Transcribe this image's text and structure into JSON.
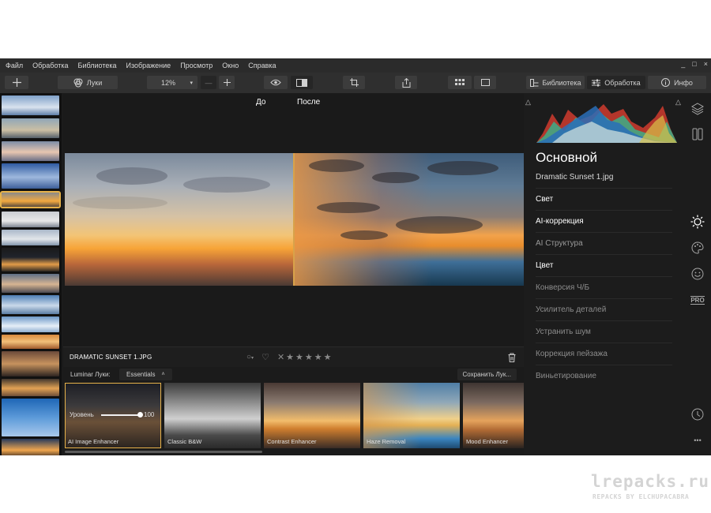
{
  "menu": [
    "Файл",
    "Обработка",
    "Библиотека",
    "Изображение",
    "Просмотр",
    "Окно",
    "Справка"
  ],
  "window_controls": [
    "_",
    "□",
    "×"
  ],
  "toolbar": {
    "looks_label": "Луки",
    "zoom": "12%",
    "zoom_minus": "—",
    "library_label": "Библиотека",
    "edit_label": "Обработка",
    "info_label": "Инфо"
  },
  "viewer": {
    "before_label": "До",
    "after_label": "После"
  },
  "infobar": {
    "filename": "DRAMATIC SUNSET 1.JPG",
    "stars": [
      "★",
      "★",
      "★",
      "★",
      "★"
    ]
  },
  "looks": {
    "label": "Luminar Луки:",
    "category": "Essentials",
    "save_label": "Сохранить Лук...",
    "level_label": "Уровень",
    "level_value": "100",
    "level_fraction": 1.0,
    "items": [
      {
        "name": "AI Image Enhancer"
      },
      {
        "name": "Classic B&W"
      },
      {
        "name": "Contrast Enhancer"
      },
      {
        "name": "Haze Removal"
      },
      {
        "name": "Mood Enhancer"
      }
    ]
  },
  "panel": {
    "title": "Основной",
    "file": "Dramatic Sunset 1.jpg",
    "tools": [
      {
        "label": "Свет",
        "color": "#ffffff"
      },
      {
        "label": "AI-коррекция",
        "color": "#ffffff"
      },
      {
        "label": "AI Структура",
        "color": "#9a9a9a"
      },
      {
        "label": "Цвет",
        "color": "#ffffff"
      },
      {
        "label": "Конверсия Ч/Б",
        "color": "#8c8c8c"
      },
      {
        "label": "Усилитель деталей",
        "color": "#8c8c8c"
      },
      {
        "label": "Устранить шум",
        "color": "#8c8c8c"
      },
      {
        "label": "Коррекция пейзажа",
        "color": "#8c8c8c"
      },
      {
        "label": "Виньетирование",
        "color": "#8c8c8c"
      }
    ],
    "pro_badge": "PRO",
    "more": "•••"
  },
  "watermark": {
    "site": "lrepacks.ru",
    "credit": "REPACKS BY ELCHUPACABRA"
  },
  "colors": {
    "accent": "#e7b24a",
    "background": "#1b1b1b"
  }
}
